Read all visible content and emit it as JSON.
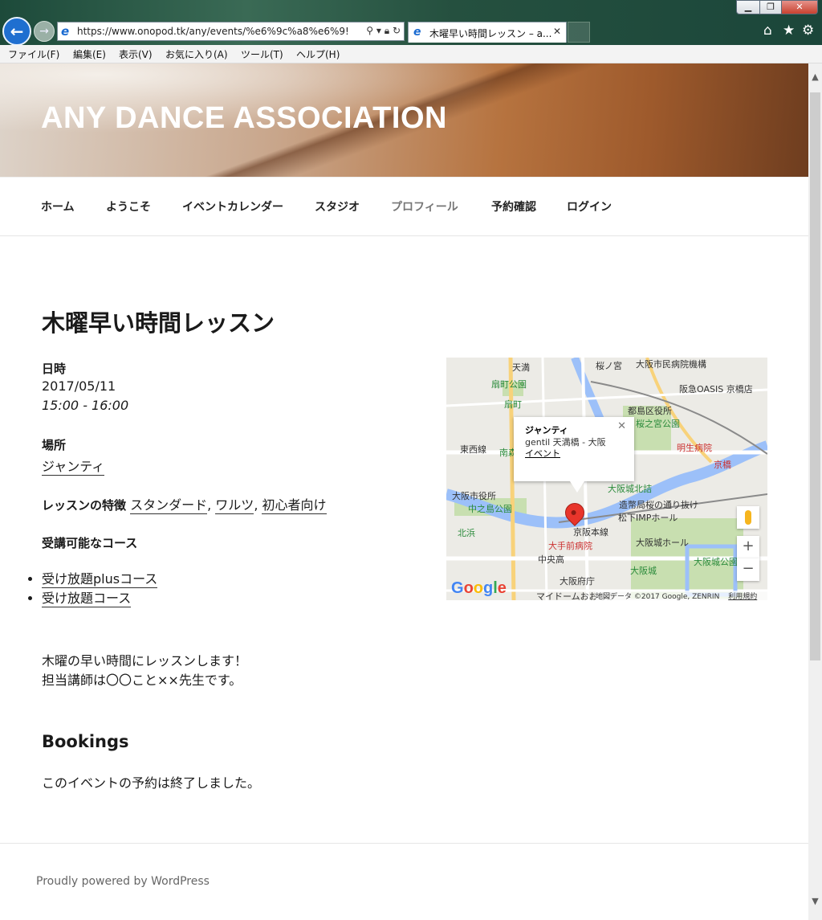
{
  "browser": {
    "url": "https://www.onopod.tk/any/events/%e6%9c%a8%e6%9!",
    "tab_title": "木曜早い時間レッスン – a...",
    "tab_close": "✕",
    "window_min": "▁",
    "window_max": "❐",
    "window_close": "✕",
    "menu": [
      "ファイル(F)",
      "編集(E)",
      "表示(V)",
      "お気に入り(A)",
      "ツール(T)",
      "ヘルプ(H)"
    ],
    "icons": [
      "home-icon",
      "star-icon",
      "gear-icon"
    ]
  },
  "site": {
    "title": "ANY DANCE ASSOCIATION",
    "nav": [
      "ホーム",
      "ようこそ",
      "イベントカレンダー",
      "スタジオ",
      "プロフィール",
      "予約確認",
      "ログイン"
    ]
  },
  "event": {
    "title": "木曜早い時間レッスン",
    "datetime_label": "日時",
    "date": "2017/05/11",
    "time": "15:00 - 16:00",
    "location_label": "場所",
    "location": "ジャンティ",
    "features_label": "レッスンの特徴",
    "features": [
      "スタンダード",
      "ワルツ",
      "初心者向け"
    ],
    "courses_label": "受講可能なコース",
    "courses": [
      "受け放題plusコース",
      "受け放題コース"
    ],
    "description_line1": "木曜の早い時間にレッスンします！",
    "description_line2": "担当講師は〇〇こと××先生です。"
  },
  "bookings": {
    "heading": "Bookings",
    "status": "このイベントの予約は終了しました。"
  },
  "map": {
    "info_name": "ジャンティ",
    "info_address": "gentil 天満橋 - 大阪",
    "info_link": "イベント",
    "info_close": "✕",
    "labels": [
      "天満",
      "桜ノ宮",
      "大阪市民病院機構",
      "扇町公園",
      "扇町",
      "阪急OASIS 京橋店",
      "都島区役所",
      "桜之宮公園",
      "東西線",
      "南森町",
      "明生病院",
      "京橋",
      "大阪市役所",
      "中之島公園",
      "大阪城北詰",
      "造幣局桜の通り抜け",
      "松下IMPホール",
      "北浜",
      "京阪本線",
      "大手前病院",
      "大阪城ホール",
      "中央高",
      "大阪城公園",
      "大阪城",
      "大阪府庁",
      "マイドームおおさか"
    ],
    "google": "Google",
    "attribution": "地図データ ©2017 Google, ZENRIN",
    "terms": "利用規約",
    "zoom_in": "+",
    "zoom_out": "−"
  },
  "footer": {
    "text": "Proudly powered by WordPress"
  }
}
